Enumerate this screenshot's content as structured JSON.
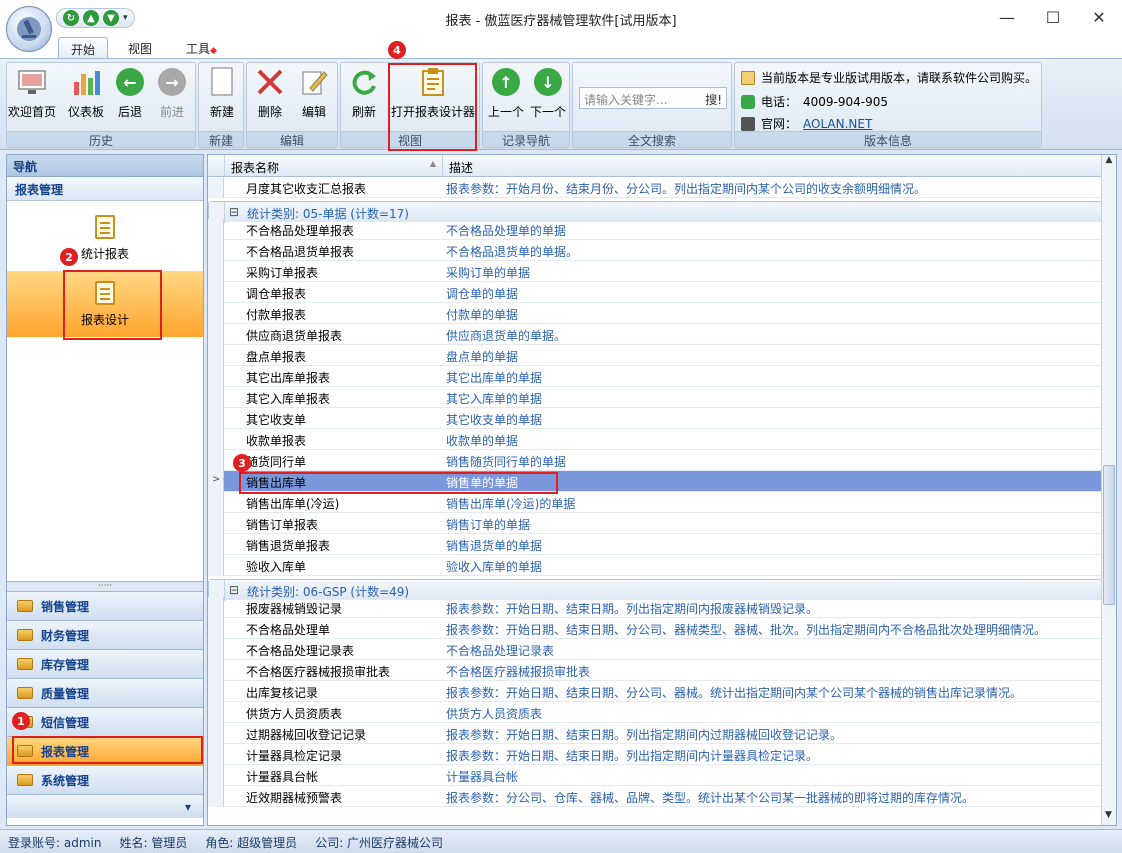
{
  "window": {
    "title": "报表 - 傲蓝医疗器械管理软件[试用版本]",
    "min": "—",
    "max": "☐",
    "close": "✕"
  },
  "ribbon_tabs": [
    "开始",
    "视图",
    "工具"
  ],
  "ribbon": {
    "history": {
      "caption": "历史",
      "home": "欢迎首页",
      "dashboard": "仪表板",
      "back": "后退",
      "forward": "前进"
    },
    "new": {
      "caption": "新建",
      "new": "新建"
    },
    "edit": {
      "caption": "编辑",
      "delete": "删除",
      "edit": "编辑"
    },
    "view": {
      "caption": "视图",
      "refresh": "刷新",
      "designer": "打开报表设计器"
    },
    "recnav": {
      "caption": "记录导航",
      "prev": "上一个",
      "next": "下一个"
    },
    "search": {
      "caption": "全文搜索",
      "placeholder": "请输入关键字...",
      "go": "搜!"
    },
    "version": {
      "caption": "版本信息",
      "notice": "当前版本是专业版试用版本，请联系软件公司购买。",
      "phone_label": "电话：",
      "phone": "4009-904-905",
      "site_label": "官网：",
      "site": "AOLAN.NET"
    }
  },
  "nav": {
    "header": "导航",
    "section": "报表管理",
    "items": [
      "统计报表",
      "报表设计"
    ],
    "grip": "·····",
    "modules": [
      "销售管理",
      "财务管理",
      "库存管理",
      "质量管理",
      "短信管理",
      "报表管理",
      "系统管理"
    ],
    "more": "▾"
  },
  "grid": {
    "columns": [
      "报表名称",
      "描述"
    ],
    "rows": [
      {
        "type": "row",
        "name": "月度其它收支汇总报表",
        "desc": "报表参数：开始月份、结束月份、分公司。列出指定期间内某个公司的收支余额明细情况。"
      },
      {
        "type": "group",
        "text": "统计类别: 05-单据 (计数=17)"
      },
      {
        "type": "row",
        "name": "不合格品处理单报表",
        "desc": "不合格品处理单的单据"
      },
      {
        "type": "row",
        "name": "不合格品退货单报表",
        "desc": "不合格品退货单的单据。"
      },
      {
        "type": "row",
        "name": "采购订单报表",
        "desc": "采购订单的单据"
      },
      {
        "type": "row",
        "name": "调仓单报表",
        "desc": "调仓单的单据"
      },
      {
        "type": "row",
        "name": "付款单报表",
        "desc": "付款单的单据"
      },
      {
        "type": "row",
        "name": "供应商退货单报表",
        "desc": "供应商退货单的单据。"
      },
      {
        "type": "row",
        "name": "盘点单报表",
        "desc": "盘点单的单据"
      },
      {
        "type": "row",
        "name": "其它出库单报表",
        "desc": "其它出库单的单据"
      },
      {
        "type": "row",
        "name": "其它入库单报表",
        "desc": "其它入库单的单据"
      },
      {
        "type": "row",
        "name": "其它收支单",
        "desc": "其它收支单的单据"
      },
      {
        "type": "row",
        "name": "收款单报表",
        "desc": "收款单的单据"
      },
      {
        "type": "row",
        "name": "随货同行单",
        "desc": "销售随货同行单的单据"
      },
      {
        "type": "row",
        "name": "销售出库单",
        "desc": "销售单的单据",
        "selected": true
      },
      {
        "type": "row",
        "name": "销售出库单(冷运)",
        "desc": "销售出库单(冷运)的单据"
      },
      {
        "type": "row",
        "name": "销售订单报表",
        "desc": "销售订单的单据"
      },
      {
        "type": "row",
        "name": "销售退货单报表",
        "desc": "销售退货单的单据"
      },
      {
        "type": "row",
        "name": "验收入库单",
        "desc": "验收入库单的单据"
      },
      {
        "type": "group",
        "text": "统计类别: 06-GSP (计数=49)"
      },
      {
        "type": "row",
        "name": "报废器械销毁记录",
        "desc": "报表参数：开始日期、结束日期。列出指定期间内报废器械销毁记录。"
      },
      {
        "type": "row",
        "name": "不合格品处理单",
        "desc": "报表参数：开始日期、结束日期、分公司、器械类型、器械、批次。列出指定期间内不合格品批次处理明细情况。"
      },
      {
        "type": "row",
        "name": "不合格品处理记录表",
        "desc": "不合格品处理记录表"
      },
      {
        "type": "row",
        "name": "不合格医疗器械报损审批表",
        "desc": "不合格医疗器械报损审批表"
      },
      {
        "type": "row",
        "name": "出库复核记录",
        "desc": "报表参数：开始日期、结束日期、分公司、器械。统计出指定期间内某个公司某个器械的销售出库记录情况。"
      },
      {
        "type": "row",
        "name": "供货方人员资质表",
        "desc": "供货方人员资质表"
      },
      {
        "type": "row",
        "name": "过期器械回收登记记录",
        "desc": "报表参数：开始日期、结束日期。列出指定期间内过期器械回收登记记录。"
      },
      {
        "type": "row",
        "name": "计量器具检定记录",
        "desc": "报表参数：开始日期、结束日期。列出指定期间内计量器具检定记录。"
      },
      {
        "type": "row",
        "name": "计量器具台帐",
        "desc": "计量器具台帐"
      },
      {
        "type": "row",
        "name": "近效期器械预警表",
        "desc": "报表参数：分公司、仓库、器械、品牌、类型。统计出某个公司某一批器械的即将过期的库存情况。"
      }
    ]
  },
  "status": {
    "account": "登录账号: admin",
    "name": "姓名: 管理员",
    "role": "角色: 超级管理员",
    "company": "公司: 广州医疗器械公司"
  },
  "annotations": [
    "1",
    "2",
    "3",
    "4"
  ]
}
